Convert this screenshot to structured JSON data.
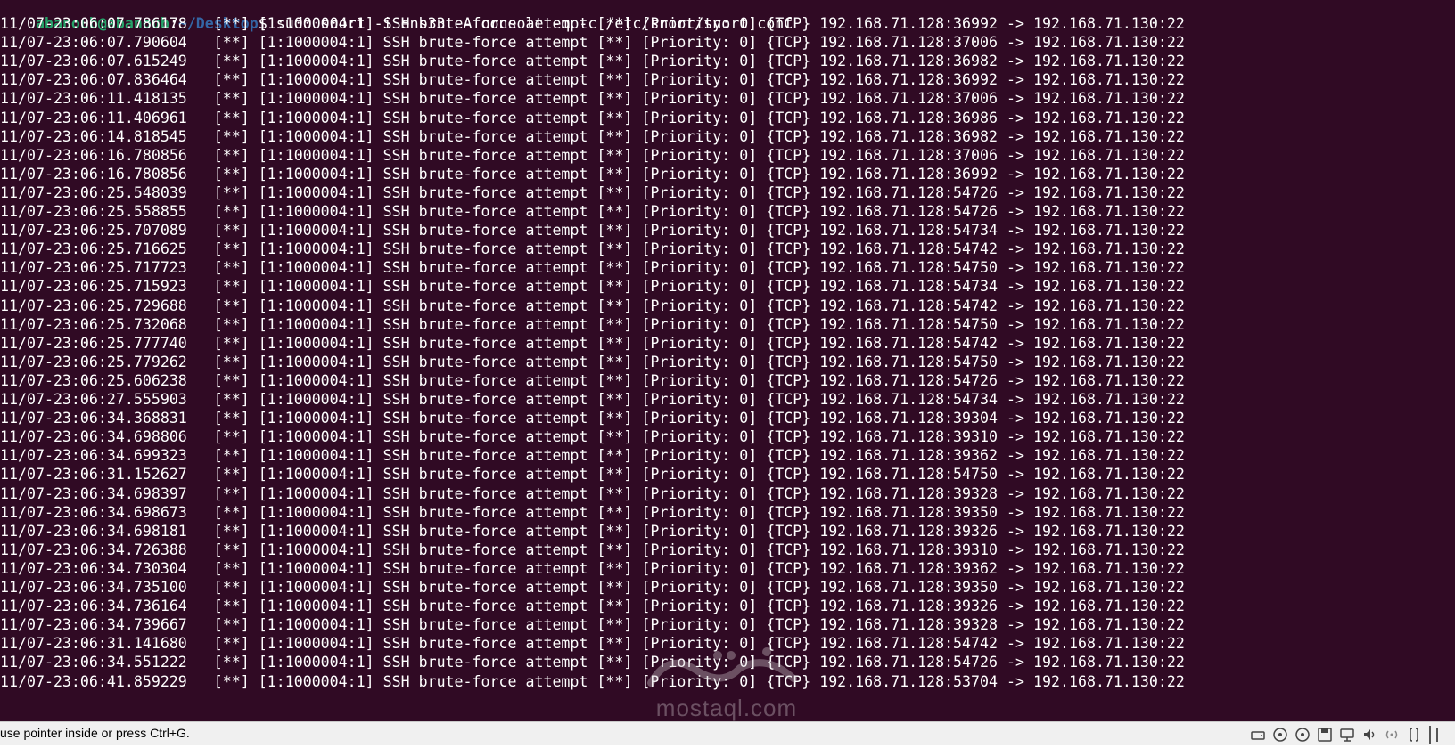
{
  "terminal": {
    "background": "#300a24",
    "prompt": {
      "user_host": "abanoub@abanoub",
      "colon": ":",
      "path": "~/Desktop",
      "dollar": "$ ",
      "command": "sudo snort -i ens33 -A console -q -c /etc/snort/snort.conf"
    },
    "log_columns": [
      "timestamp",
      "marker_open",
      "rule_id",
      "message",
      "marker_close",
      "priority",
      "protocol",
      "source",
      "arrow",
      "destination"
    ],
    "log_lines": [
      [
        "11/07-23:06:07.786178",
        "[**]",
        "[1:1000004:1]",
        "SSH brute-force attempt",
        "[**]",
        "[Priority: 0]",
        "{TCP}",
        "192.168.71.128:36992",
        "->",
        "192.168.71.130:22"
      ],
      [
        "11/07-23:06:07.790604",
        "[**]",
        "[1:1000004:1]",
        "SSH brute-force attempt",
        "[**]",
        "[Priority: 0]",
        "{TCP}",
        "192.168.71.128:37006",
        "->",
        "192.168.71.130:22"
      ],
      [
        "11/07-23:06:07.615249",
        "[**]",
        "[1:1000004:1]",
        "SSH brute-force attempt",
        "[**]",
        "[Priority: 0]",
        "{TCP}",
        "192.168.71.128:36982",
        "->",
        "192.168.71.130:22"
      ],
      [
        "11/07-23:06:07.836464",
        "[**]",
        "[1:1000004:1]",
        "SSH brute-force attempt",
        "[**]",
        "[Priority: 0]",
        "{TCP}",
        "192.168.71.128:36992",
        "->",
        "192.168.71.130:22"
      ],
      [
        "11/07-23:06:11.418135",
        "[**]",
        "[1:1000004:1]",
        "SSH brute-force attempt",
        "[**]",
        "[Priority: 0]",
        "{TCP}",
        "192.168.71.128:37006",
        "->",
        "192.168.71.130:22"
      ],
      [
        "11/07-23:06:11.406961",
        "[**]",
        "[1:1000004:1]",
        "SSH brute-force attempt",
        "[**]",
        "[Priority: 0]",
        "{TCP}",
        "192.168.71.128:36986",
        "->",
        "192.168.71.130:22"
      ],
      [
        "11/07-23:06:14.818545",
        "[**]",
        "[1:1000004:1]",
        "SSH brute-force attempt",
        "[**]",
        "[Priority: 0]",
        "{TCP}",
        "192.168.71.128:36982",
        "->",
        "192.168.71.130:22"
      ],
      [
        "11/07-23:06:16.780856",
        "[**]",
        "[1:1000004:1]",
        "SSH brute-force attempt",
        "[**]",
        "[Priority: 0]",
        "{TCP}",
        "192.168.71.128:37006",
        "->",
        "192.168.71.130:22"
      ],
      [
        "11/07-23:06:16.780856",
        "[**]",
        "[1:1000004:1]",
        "SSH brute-force attempt",
        "[**]",
        "[Priority: 0]",
        "{TCP}",
        "192.168.71.128:36992",
        "->",
        "192.168.71.130:22"
      ],
      [
        "11/07-23:06:25.548039",
        "[**]",
        "[1:1000004:1]",
        "SSH brute-force attempt",
        "[**]",
        "[Priority: 0]",
        "{TCP}",
        "192.168.71.128:54726",
        "->",
        "192.168.71.130:22"
      ],
      [
        "11/07-23:06:25.558855",
        "[**]",
        "[1:1000004:1]",
        "SSH brute-force attempt",
        "[**]",
        "[Priority: 0]",
        "{TCP}",
        "192.168.71.128:54726",
        "->",
        "192.168.71.130:22"
      ],
      [
        "11/07-23:06:25.707089",
        "[**]",
        "[1:1000004:1]",
        "SSH brute-force attempt",
        "[**]",
        "[Priority: 0]",
        "{TCP}",
        "192.168.71.128:54734",
        "->",
        "192.168.71.130:22"
      ],
      [
        "11/07-23:06:25.716625",
        "[**]",
        "[1:1000004:1]",
        "SSH brute-force attempt",
        "[**]",
        "[Priority: 0]",
        "{TCP}",
        "192.168.71.128:54742",
        "->",
        "192.168.71.130:22"
      ],
      [
        "11/07-23:06:25.717723",
        "[**]",
        "[1:1000004:1]",
        "SSH brute-force attempt",
        "[**]",
        "[Priority: 0]",
        "{TCP}",
        "192.168.71.128:54750",
        "->",
        "192.168.71.130:22"
      ],
      [
        "11/07-23:06:25.715923",
        "[**]",
        "[1:1000004:1]",
        "SSH brute-force attempt",
        "[**]",
        "[Priority: 0]",
        "{TCP}",
        "192.168.71.128:54734",
        "->",
        "192.168.71.130:22"
      ],
      [
        "11/07-23:06:25.729688",
        "[**]",
        "[1:1000004:1]",
        "SSH brute-force attempt",
        "[**]",
        "[Priority: 0]",
        "{TCP}",
        "192.168.71.128:54742",
        "->",
        "192.168.71.130:22"
      ],
      [
        "11/07-23:06:25.732068",
        "[**]",
        "[1:1000004:1]",
        "SSH brute-force attempt",
        "[**]",
        "[Priority: 0]",
        "{TCP}",
        "192.168.71.128:54750",
        "->",
        "192.168.71.130:22"
      ],
      [
        "11/07-23:06:25.777740",
        "[**]",
        "[1:1000004:1]",
        "SSH brute-force attempt",
        "[**]",
        "[Priority: 0]",
        "{TCP}",
        "192.168.71.128:54742",
        "->",
        "192.168.71.130:22"
      ],
      [
        "11/07-23:06:25.779262",
        "[**]",
        "[1:1000004:1]",
        "SSH brute-force attempt",
        "[**]",
        "[Priority: 0]",
        "{TCP}",
        "192.168.71.128:54750",
        "->",
        "192.168.71.130:22"
      ],
      [
        "11/07-23:06:25.606238",
        "[**]",
        "[1:1000004:1]",
        "SSH brute-force attempt",
        "[**]",
        "[Priority: 0]",
        "{TCP}",
        "192.168.71.128:54726",
        "->",
        "192.168.71.130:22"
      ],
      [
        "11/07-23:06:27.555903",
        "[**]",
        "[1:1000004:1]",
        "SSH brute-force attempt",
        "[**]",
        "[Priority: 0]",
        "{TCP}",
        "192.168.71.128:54734",
        "->",
        "192.168.71.130:22"
      ],
      [
        "11/07-23:06:34.368831",
        "[**]",
        "[1:1000004:1]",
        "SSH brute-force attempt",
        "[**]",
        "[Priority: 0]",
        "{TCP}",
        "192.168.71.128:39304",
        "->",
        "192.168.71.130:22"
      ],
      [
        "11/07-23:06:34.698806",
        "[**]",
        "[1:1000004:1]",
        "SSH brute-force attempt",
        "[**]",
        "[Priority: 0]",
        "{TCP}",
        "192.168.71.128:39310",
        "->",
        "192.168.71.130:22"
      ],
      [
        "11/07-23:06:34.699323",
        "[**]",
        "[1:1000004:1]",
        "SSH brute-force attempt",
        "[**]",
        "[Priority: 0]",
        "{TCP}",
        "192.168.71.128:39362",
        "->",
        "192.168.71.130:22"
      ],
      [
        "11/07-23:06:31.152627",
        "[**]",
        "[1:1000004:1]",
        "SSH brute-force attempt",
        "[**]",
        "[Priority: 0]",
        "{TCP}",
        "192.168.71.128:54750",
        "->",
        "192.168.71.130:22"
      ],
      [
        "11/07-23:06:34.698397",
        "[**]",
        "[1:1000004:1]",
        "SSH brute-force attempt",
        "[**]",
        "[Priority: 0]",
        "{TCP}",
        "192.168.71.128:39328",
        "->",
        "192.168.71.130:22"
      ],
      [
        "11/07-23:06:34.698673",
        "[**]",
        "[1:1000004:1]",
        "SSH brute-force attempt",
        "[**]",
        "[Priority: 0]",
        "{TCP}",
        "192.168.71.128:39350",
        "->",
        "192.168.71.130:22"
      ],
      [
        "11/07-23:06:34.698181",
        "[**]",
        "[1:1000004:1]",
        "SSH brute-force attempt",
        "[**]",
        "[Priority: 0]",
        "{TCP}",
        "192.168.71.128:39326",
        "->",
        "192.168.71.130:22"
      ],
      [
        "11/07-23:06:34.726388",
        "[**]",
        "[1:1000004:1]",
        "SSH brute-force attempt",
        "[**]",
        "[Priority: 0]",
        "{TCP}",
        "192.168.71.128:39310",
        "->",
        "192.168.71.130:22"
      ],
      [
        "11/07-23:06:34.730304",
        "[**]",
        "[1:1000004:1]",
        "SSH brute-force attempt",
        "[**]",
        "[Priority: 0]",
        "{TCP}",
        "192.168.71.128:39362",
        "->",
        "192.168.71.130:22"
      ],
      [
        "11/07-23:06:34.735100",
        "[**]",
        "[1:1000004:1]",
        "SSH brute-force attempt",
        "[**]",
        "[Priority: 0]",
        "{TCP}",
        "192.168.71.128:39350",
        "->",
        "192.168.71.130:22"
      ],
      [
        "11/07-23:06:34.736164",
        "[**]",
        "[1:1000004:1]",
        "SSH brute-force attempt",
        "[**]",
        "[Priority: 0]",
        "{TCP}",
        "192.168.71.128:39326",
        "->",
        "192.168.71.130:22"
      ],
      [
        "11/07-23:06:34.739667",
        "[**]",
        "[1:1000004:1]",
        "SSH brute-force attempt",
        "[**]",
        "[Priority: 0]",
        "{TCP}",
        "192.168.71.128:39328",
        "->",
        "192.168.71.130:22"
      ],
      [
        "11/07-23:06:31.141680",
        "[**]",
        "[1:1000004:1]",
        "SSH brute-force attempt",
        "[**]",
        "[Priority: 0]",
        "{TCP}",
        "192.168.71.128:54742",
        "->",
        "192.168.71.130:22"
      ],
      [
        "11/07-23:06:34.551222",
        "[**]",
        "[1:1000004:1]",
        "SSH brute-force attempt",
        "[**]",
        "[Priority: 0]",
        "{TCP}",
        "192.168.71.128:54726",
        "->",
        "192.168.71.130:22"
      ],
      [
        "11/07-23:06:41.859229",
        "[**]",
        "[1:1000004:1]",
        "SSH brute-force attempt",
        "[**]",
        "[Priority: 0]",
        "{TCP}",
        "192.168.71.128:53704",
        "->",
        "192.168.71.130:22"
      ]
    ]
  },
  "watermark": {
    "text": "mostaql.com"
  },
  "statusbar": {
    "message": "use pointer inside or press Ctrl+G.",
    "tray_icons": [
      "hard-disk-icon",
      "optical-drive-icon",
      "optical-drive-icon",
      "floppy-disk-icon",
      "network-icon",
      "audio-icon",
      "wireless-icon",
      "usb-icon",
      "host-key-icon"
    ]
  }
}
